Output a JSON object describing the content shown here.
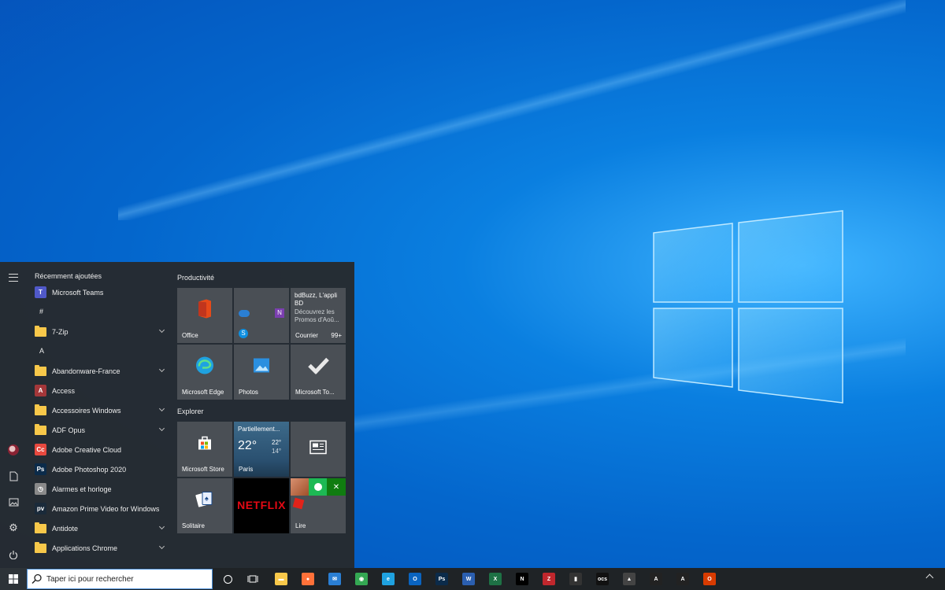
{
  "start_menu": {
    "recent_header": "Récemment ajoutées",
    "apps": [
      {
        "type": "app",
        "label": "Microsoft Teams",
        "icon": "teams-icon",
        "color": "#5059c9",
        "glyph": "T"
      },
      {
        "type": "letter",
        "label": "#"
      },
      {
        "type": "folder",
        "label": "7-Zip",
        "expandable": true
      },
      {
        "type": "letter",
        "label": "A"
      },
      {
        "type": "folder",
        "label": "Abandonware-France",
        "expandable": true
      },
      {
        "type": "app",
        "label": "Access",
        "icon": "access-icon",
        "color": "#a4373a",
        "glyph": "A"
      },
      {
        "type": "folder",
        "label": "Accessoires Windows",
        "expandable": true
      },
      {
        "type": "folder",
        "label": "ADF Opus",
        "expandable": true
      },
      {
        "type": "app",
        "label": "Adobe Creative Cloud",
        "icon": "creative-cloud-icon",
        "color": "#e8493f",
        "glyph": "Cc"
      },
      {
        "type": "app",
        "label": "Adobe Photoshop 2020",
        "icon": "photoshop-icon",
        "color": "#0b2b4a",
        "glyph": "Ps"
      },
      {
        "type": "app",
        "label": "Alarmes et horloge",
        "icon": "alarm-icon",
        "color": "#8a8a8a",
        "glyph": "◷"
      },
      {
        "type": "app",
        "label": "Amazon Prime Video for Windows",
        "icon": "prime-video-icon",
        "color": "#1a2a3a",
        "glyph": "pv"
      },
      {
        "type": "folder",
        "label": "Antidote",
        "expandable": true
      },
      {
        "type": "folder",
        "label": "Applications Chrome",
        "expandable": true
      }
    ],
    "groups": [
      {
        "title": "Productivité"
      },
      {
        "title": "Explorer"
      }
    ],
    "tiles": {
      "office": {
        "label": "Office"
      },
      "mail": {
        "title": "bdBuzz, L'appli BD",
        "body": "Découvrez les Promos d'Aoû...",
        "label": "Courrier",
        "count": "99+"
      },
      "edge": {
        "label": "Microsoft Edge"
      },
      "photos": {
        "label": "Photos"
      },
      "todo": {
        "label": "Microsoft To..."
      },
      "store": {
        "label": "Microsoft Store"
      },
      "weather": {
        "condition": "Partiellement...",
        "temp": "22°",
        "high": "22°",
        "low": "14°",
        "city": "Paris"
      },
      "news": {
        "label": ""
      },
      "solitaire": {
        "label": "Solitaire"
      },
      "netflix": {
        "label": "NETFLIX"
      },
      "play": {
        "label": "Lire"
      }
    }
  },
  "taskbar": {
    "search_placeholder": "Taper ici pour rechercher",
    "pinned": [
      {
        "name": "file-explorer-icon",
        "color": "#f8c84a",
        "glyph": "▬"
      },
      {
        "name": "firefox-icon",
        "color": "#ff7139",
        "glyph": "●"
      },
      {
        "name": "mail-app-icon",
        "color": "#2a7fd4",
        "glyph": "✉"
      },
      {
        "name": "chrome-icon",
        "color": "#34a853",
        "glyph": "◉"
      },
      {
        "name": "edge-icon",
        "color": "#1fa2e0",
        "glyph": "e"
      },
      {
        "name": "outlook-icon",
        "color": "#0a64c0",
        "glyph": "O"
      },
      {
        "name": "photoshop-icon",
        "color": "#0b2b4a",
        "glyph": "Ps"
      },
      {
        "name": "word-icon",
        "color": "#2b5fb0",
        "glyph": "W"
      },
      {
        "name": "excel-icon",
        "color": "#1e7145",
        "glyph": "X"
      },
      {
        "name": "netflix-icon",
        "color": "#000000",
        "glyph": "N"
      },
      {
        "name": "filezilla-icon",
        "color": "#c0272d",
        "glyph": "Z"
      },
      {
        "name": "audio-app-icon",
        "color": "#333333",
        "glyph": "▮"
      },
      {
        "name": "ocs-icon",
        "color": "#111111",
        "glyph": "ocs"
      },
      {
        "name": "mountain-app-icon",
        "color": "#444444",
        "glyph": "▲"
      },
      {
        "name": "atari-icon",
        "color": "#222222",
        "glyph": "A"
      },
      {
        "name": "atari-color-icon",
        "color": "#222222",
        "glyph": "A"
      },
      {
        "name": "office-icon",
        "color": "#d83b01",
        "glyph": "O"
      }
    ]
  },
  "colors": {
    "accent": "#0a7fe0",
    "menu_bg": "#262a2e",
    "tile_bg": "#4a4f55"
  }
}
